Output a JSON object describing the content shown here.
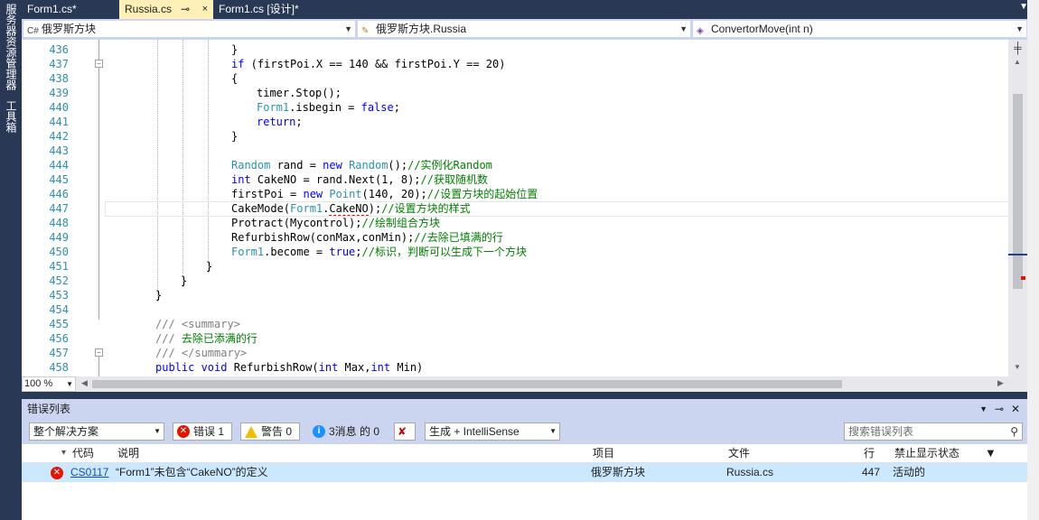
{
  "left_toolwindows": [
    "服务器资源管理器",
    "工具箱"
  ],
  "tabs": [
    {
      "label": "Form1.cs*",
      "active": false
    },
    {
      "label": "Russia.cs",
      "active": true,
      "pin": "⊸",
      "close": "×"
    },
    {
      "label": "Form1.cs [设计]*",
      "active": false
    }
  ],
  "navbar": {
    "project": "俄罗斯方块",
    "class": "俄罗斯方块.Russia",
    "member": "ConvertorMove(int n)"
  },
  "editor": {
    "line_numbers": [
      "436",
      "437",
      "438",
      "439",
      "440",
      "441",
      "442",
      "443",
      "444",
      "445",
      "446",
      "447",
      "448",
      "449",
      "450",
      "451",
      "452",
      "453",
      "454",
      "455",
      "456",
      "457",
      "458"
    ],
    "lines": {
      "l436": "}",
      "l437_if": "if",
      "l437_rest": " (firstPoi.X == 140 && firstPoi.Y == 20)",
      "l438": "{",
      "l439": "timer.Stop();",
      "l440_type": "Form1",
      "l440_mid": ".isbegin = ",
      "l440_kw": "false",
      "l440_end": ";",
      "l441_kw": "return",
      "l441_end": ";",
      "l442": "}",
      "l444_type": "Random",
      "l444_mid": " rand = ",
      "l444_kw": "new",
      "l444_type2": " Random",
      "l444_end": "();",
      "l444_cm": "//实例化Random",
      "l445_kw": "int",
      "l445_mid": " CakeNO = rand.Next(1, 8);",
      "l445_cm": "//获取随机数",
      "l446_mid": "firstPoi = ",
      "l446_kw": "new",
      "l446_type": " Point",
      "l446_end": "(140, 20);",
      "l446_cm": "//设置方块的起始位置",
      "l447_a": "CakeMode(",
      "l447_type": "Form1",
      "l447_dot": ".",
      "l447_err": "CakeNO",
      "l447_end": ");",
      "l447_cm": "//设置方块的样式",
      "l448": "Protract(Mycontrol);",
      "l448_cm": "//绘制组合方块",
      "l449": "RefurbishRow(conMax,conMin);",
      "l449_cm": "//去除已填满的行",
      "l450_type": "Form1",
      "l450_mid": ".become = ",
      "l450_kw": "true",
      "l450_end": ";",
      "l450_cm": "//标识，判断可以生成下一个方块",
      "l451": "}",
      "l452": "}",
      "l453": "}",
      "l455_gr": "/// <summary>",
      "l456_gr": "///",
      "l456_cm": " 去除已添满的行",
      "l457_gr": "/// </summary>",
      "l458_kw1": "public",
      "l458_kw2": " void",
      "l458_mid": " RefurbishRow(",
      "l458_kw3": "int",
      "l458_mid2": " Max,",
      "l458_kw4": "int",
      "l458_end": " Min)"
    },
    "zoom": "100 %"
  },
  "error_list": {
    "title": "错误列表",
    "scope": "整个解决方案",
    "errors_btn": "错误 1",
    "warnings_btn": "警告 0",
    "messages_btn": "3消息 的 0",
    "build_filter": "生成 + IntelliSense",
    "search_placeholder": "搜索错误列表",
    "columns": [
      "代码",
      "说明",
      "项目",
      "文件",
      "行",
      "禁止显示状态"
    ],
    "rows": [
      {
        "code": "CS0117",
        "description": "“Form1”未包含“CakeNO”的定义",
        "project": "俄罗斯方块",
        "file": "Russia.cs",
        "line": "447",
        "suppression": "活动的"
      }
    ]
  },
  "colors": {
    "ide_bg": "#293955",
    "active_tab": "#fff0b8",
    "keyword": "#0000ff",
    "type": "#2b91af",
    "comment": "#008000",
    "error": "#e51400"
  }
}
